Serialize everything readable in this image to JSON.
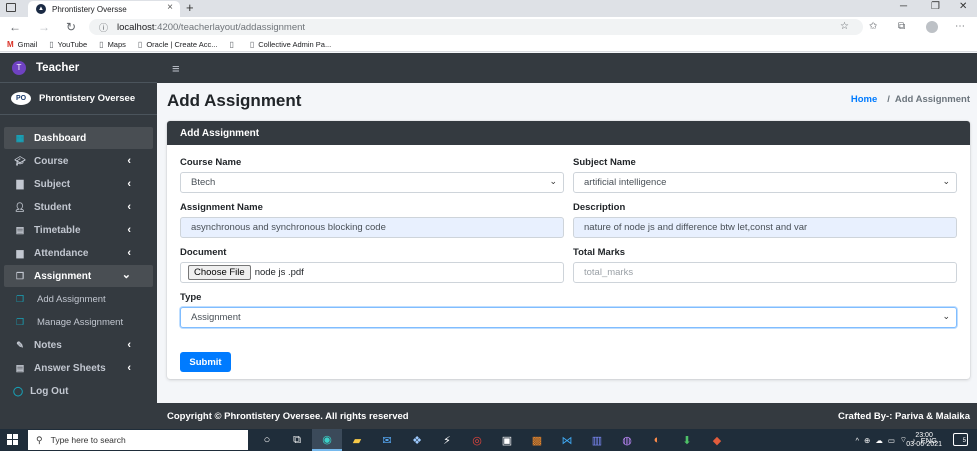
{
  "browser": {
    "tab_title": "Phrontistery Oversse",
    "tab_close": "×",
    "new_tab": "+",
    "url_host": "localhost",
    "url_path": ":4200/teacherlayout/addassignment",
    "bookmarks": [
      {
        "label": "Gmail",
        "icon": "gmail-icon"
      },
      {
        "label": "YouTube",
        "icon": "page-icon"
      },
      {
        "label": "Maps",
        "icon": "page-icon"
      },
      {
        "label": "Oracle | Create Acc...",
        "icon": "page-icon"
      },
      {
        "label": "",
        "icon": "page-icon"
      },
      {
        "label": "Collective Admin Pa...",
        "icon": "page-icon"
      }
    ]
  },
  "sidebar": {
    "brand": "Teacher",
    "brand_avatar": "T",
    "user_name": "Phrontistery Oversee",
    "items": [
      {
        "label": "Dashboard",
        "icon": "dashboard-icon",
        "chevron": ""
      },
      {
        "label": "Course",
        "icon": "graduation-cap-icon",
        "chevron": "‹"
      },
      {
        "label": "Subject",
        "icon": "file-icon",
        "chevron": "‹"
      },
      {
        "label": "Student",
        "icon": "user-icon",
        "chevron": "‹"
      },
      {
        "label": "Timetable",
        "icon": "calendar-icon",
        "chevron": "‹"
      },
      {
        "label": "Attendance",
        "icon": "clipboard-icon",
        "chevron": "‹"
      },
      {
        "label": "Assignment",
        "icon": "copy-icon",
        "chevron": "⌄"
      }
    ],
    "sub_items": [
      {
        "label": "Add Assignment"
      },
      {
        "label": "Manage Assignment"
      }
    ],
    "notes": {
      "label": "Notes",
      "chevron": "‹"
    },
    "answer_sheets": {
      "label": "Answer Sheets",
      "chevron": "‹"
    },
    "logout": "Log Out"
  },
  "header": {
    "title": "Add Assignment",
    "breadcrumb_home": "Home",
    "breadcrumb_sep": "/",
    "breadcrumb_current": "Add Assignment"
  },
  "form": {
    "card_title": "Add Assignment",
    "course_label": "Course Name",
    "course_value": "Btech",
    "subject_label": "Subject Name",
    "subject_value": "artificial intelligence",
    "assignment_name_label": "Assignment Name",
    "assignment_name_value": "asynchronous and synchronous blocking code",
    "description_label": "Description",
    "description_value": "nature of node js and difference btw let,const and var",
    "document_label": "Document",
    "choose_file": "Choose File",
    "file_name": "node js .pdf",
    "total_marks_label": "Total Marks",
    "total_marks_placeholder": "total_marks",
    "type_label": "Type",
    "type_value": "Assignment",
    "submit": "Submit"
  },
  "footer": {
    "copyright": "Copyright © Phrontistery Oversee.  All rights reserved",
    "credits": "Crafted By-: Pariva & Malaika"
  },
  "taskbar": {
    "search_placeholder": "Type here to search",
    "lang": "ENG",
    "time": "23:00",
    "date": "03-06-2021",
    "notification_count": "5"
  }
}
